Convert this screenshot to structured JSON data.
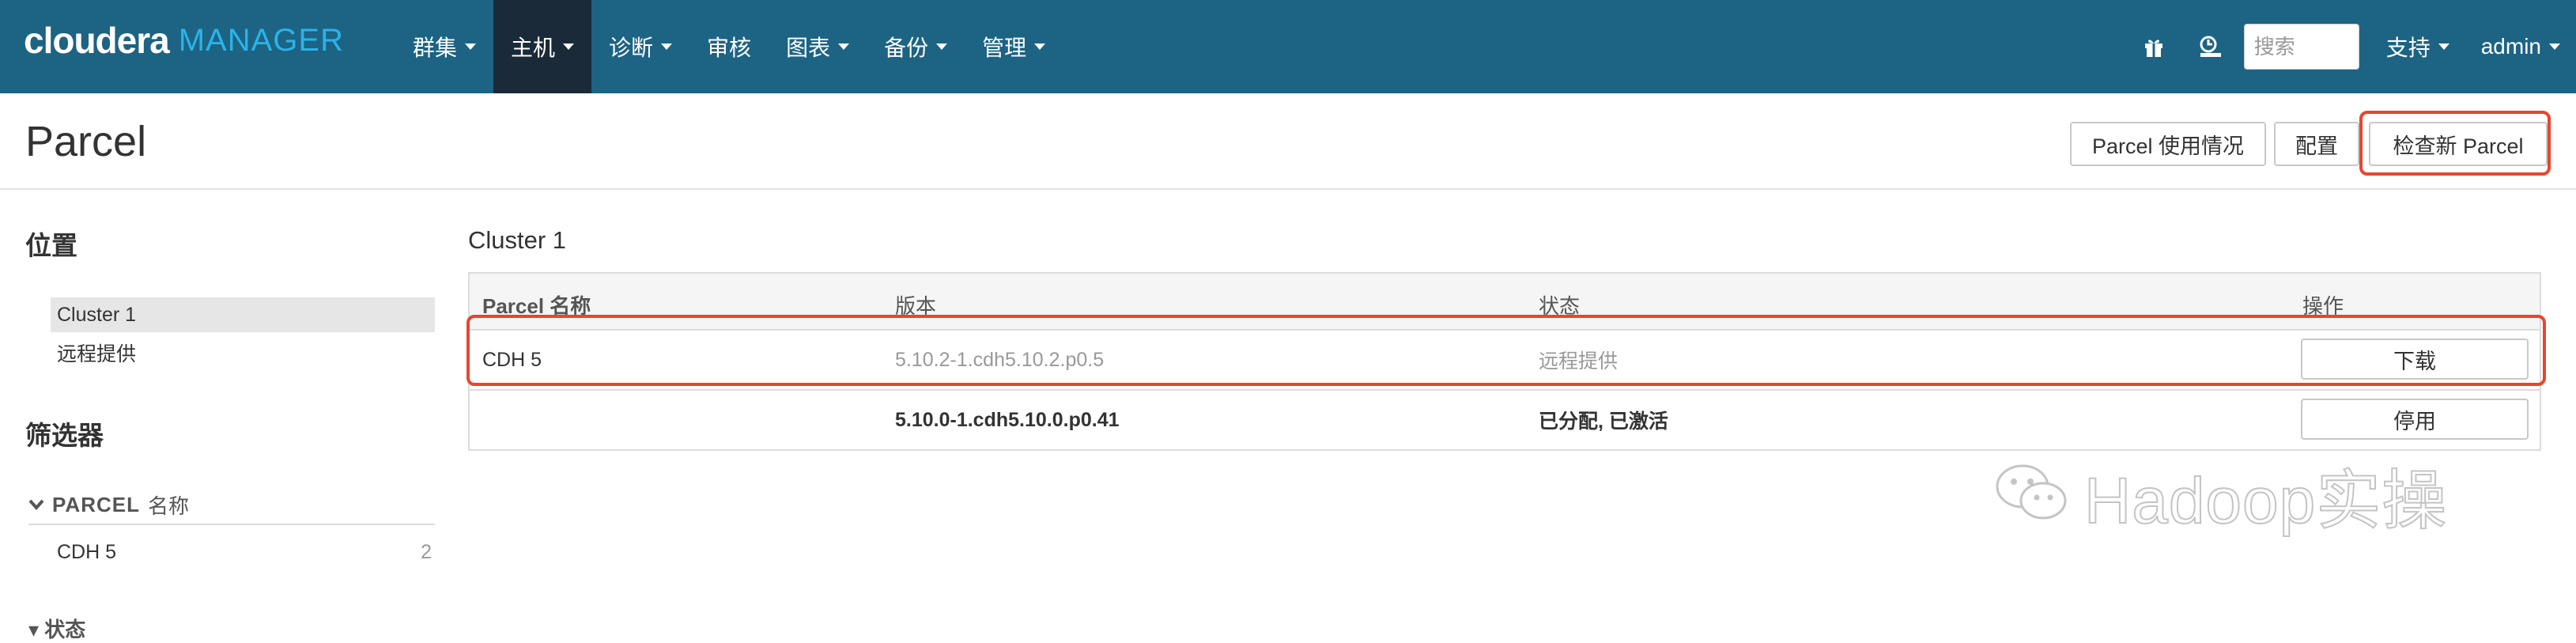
{
  "navbar": {
    "logo_brand": "cloudera",
    "logo_product": "MANAGER",
    "menu": [
      {
        "label": "群集"
      },
      {
        "label": "主机"
      },
      {
        "label": "诊断"
      },
      {
        "label": "审核"
      },
      {
        "label": "图表"
      },
      {
        "label": "备份"
      },
      {
        "label": "管理"
      }
    ],
    "search_placeholder": "搜索",
    "support_label": "支持",
    "user_label": "admin",
    "bg_color": "#1d6383",
    "active_color": "#1a2a38",
    "icons": [
      "gift-icon",
      "running-commands-icon"
    ]
  },
  "header": {
    "title": "Parcel",
    "usage_button": "Parcel 使用情况",
    "config_button": "配置",
    "check_button": "检查新 Parcel"
  },
  "sidebar": {
    "location_heading": "位置",
    "locations": [
      "Cluster 1",
      "远程提供"
    ],
    "filter_heading": "筛选器",
    "filter_group_name": "PARCEL",
    "filter_group_suffix": "名称",
    "filter_items": [
      {
        "label": "CDH 5",
        "count": "2"
      }
    ],
    "status_group_label": "状态"
  },
  "main": {
    "cluster_title": "Cluster 1",
    "columns": [
      "Parcel 名称",
      "版本",
      "状态",
      "操作"
    ],
    "rows": [
      {
        "name": "CDH 5",
        "version": "5.10.2-1.cdh5.10.2.p0.5",
        "status": "远程提供",
        "action": "下载"
      },
      {
        "name": "",
        "version": "5.10.0-1.cdh5.10.0.p0.41",
        "status": "已分配, 已激活",
        "action": "停用"
      }
    ]
  },
  "watermark": {
    "text": "Hadoop实操"
  },
  "highlight_color": "#e8462e"
}
